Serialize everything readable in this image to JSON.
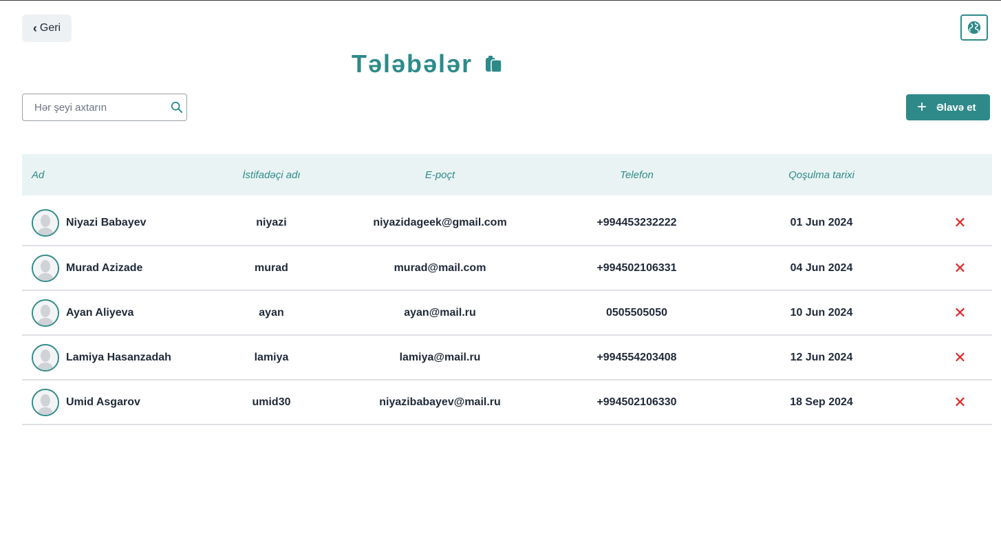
{
  "header": {
    "back_label": "Geri",
    "title": "Tələbələr",
    "language_icon": "globe-icon",
    "title_icon": "clipboard-icon"
  },
  "toolbar": {
    "search_placeholder": "Hər şeyi axtarın",
    "add_label": "Əlavə et"
  },
  "table": {
    "columns": [
      "Ad",
      "İstifadəçi adı",
      "E-poçt",
      "Telefon",
      "Qoşulma tarixi"
    ],
    "rows": [
      {
        "name": "Niyazi Babayev",
        "username": "niyazi",
        "email": "niyazidageek@gmail.com",
        "phone": "+994453232222",
        "joined": "01 Jun 2024"
      },
      {
        "name": "Murad Azizade",
        "username": "murad",
        "email": "murad@mail.com",
        "phone": "+994502106331",
        "joined": "04 Jun 2024"
      },
      {
        "name": "Ayan Aliyeva",
        "username": "ayan",
        "email": "ayan@mail.ru",
        "phone": "0505505050",
        "joined": "10 Jun 2024"
      },
      {
        "name": "Lamiya Hasanzadah",
        "username": "lamiya",
        "email": "lamiya@mail.ru",
        "phone": "+994554203408",
        "joined": "12 Jun 2024"
      },
      {
        "name": "Umid Asgarov",
        "username": "umid30",
        "email": "niyazibabayev@mail.ru",
        "phone": "+994502106330",
        "joined": "18 Sep 2024"
      }
    ],
    "delete_symbol": "✕"
  },
  "colors": {
    "accent": "#2e8a89",
    "header_bg": "#eaf3f3",
    "delete": "#e02424"
  }
}
